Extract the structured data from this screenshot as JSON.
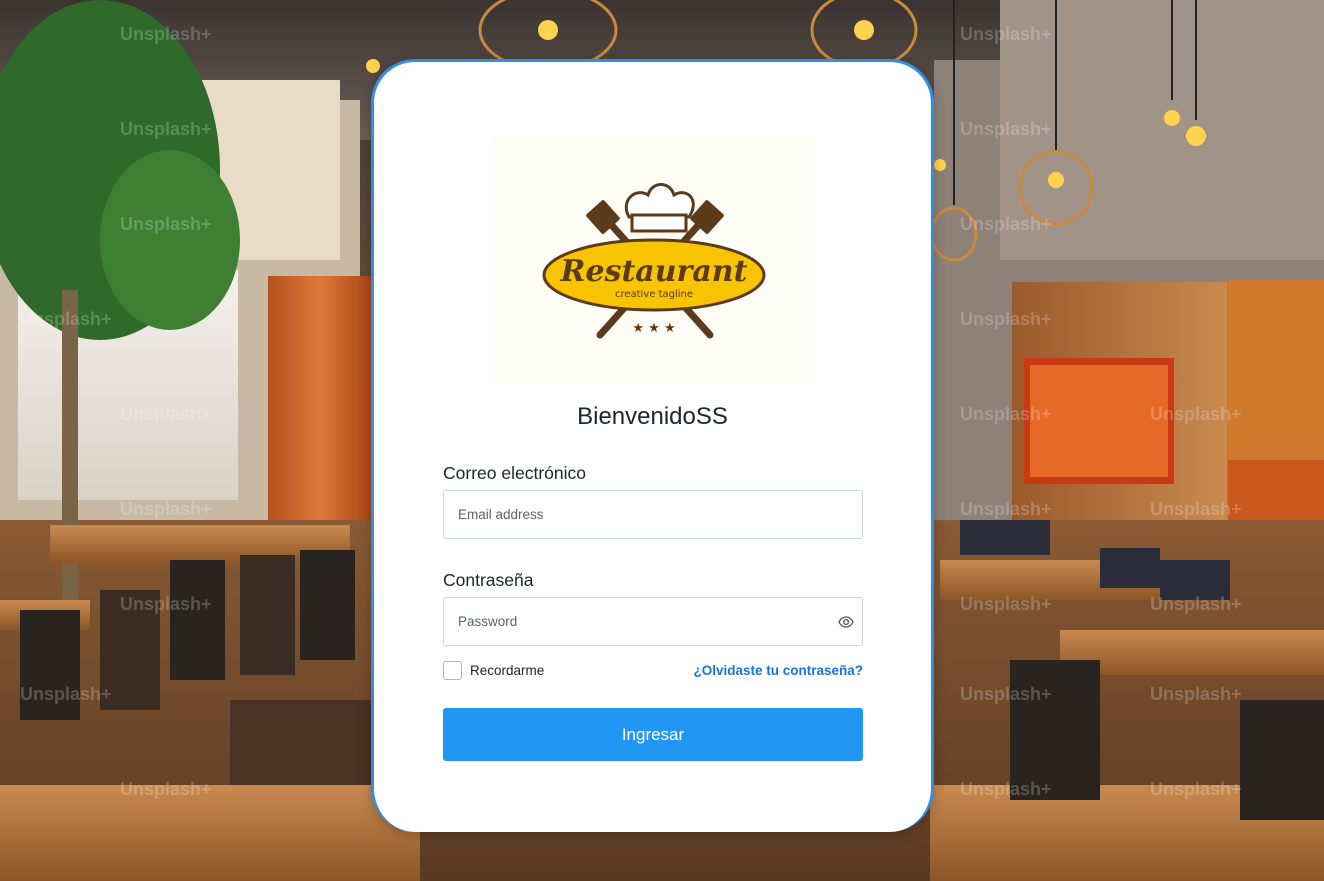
{
  "logo": {
    "name": "Restaurant",
    "tagline": "creative tagline",
    "stars": "★ ★ ★",
    "colors": {
      "brand_yellow": "#f8c400",
      "brand_brown": "#5c3a1c"
    }
  },
  "login": {
    "welcome": "BienvenidoSS",
    "email_label": "Correo electrónico",
    "email_placeholder": "Email address",
    "email_value": "",
    "password_label": "Contraseña",
    "password_placeholder": "Password",
    "password_value": "",
    "remember_label": "Recordarme",
    "remember_checked": false,
    "forgot_link": "¿Olvidaste tu contraseña?",
    "submit_label": "Ingresar"
  },
  "background": {
    "watermark": "Unsplash+"
  },
  "colors": {
    "accent": "#2196f3",
    "card_border": "#2f8fe6",
    "link": "#1a73d9"
  },
  "icons": {
    "password_toggle": "eye-icon"
  }
}
